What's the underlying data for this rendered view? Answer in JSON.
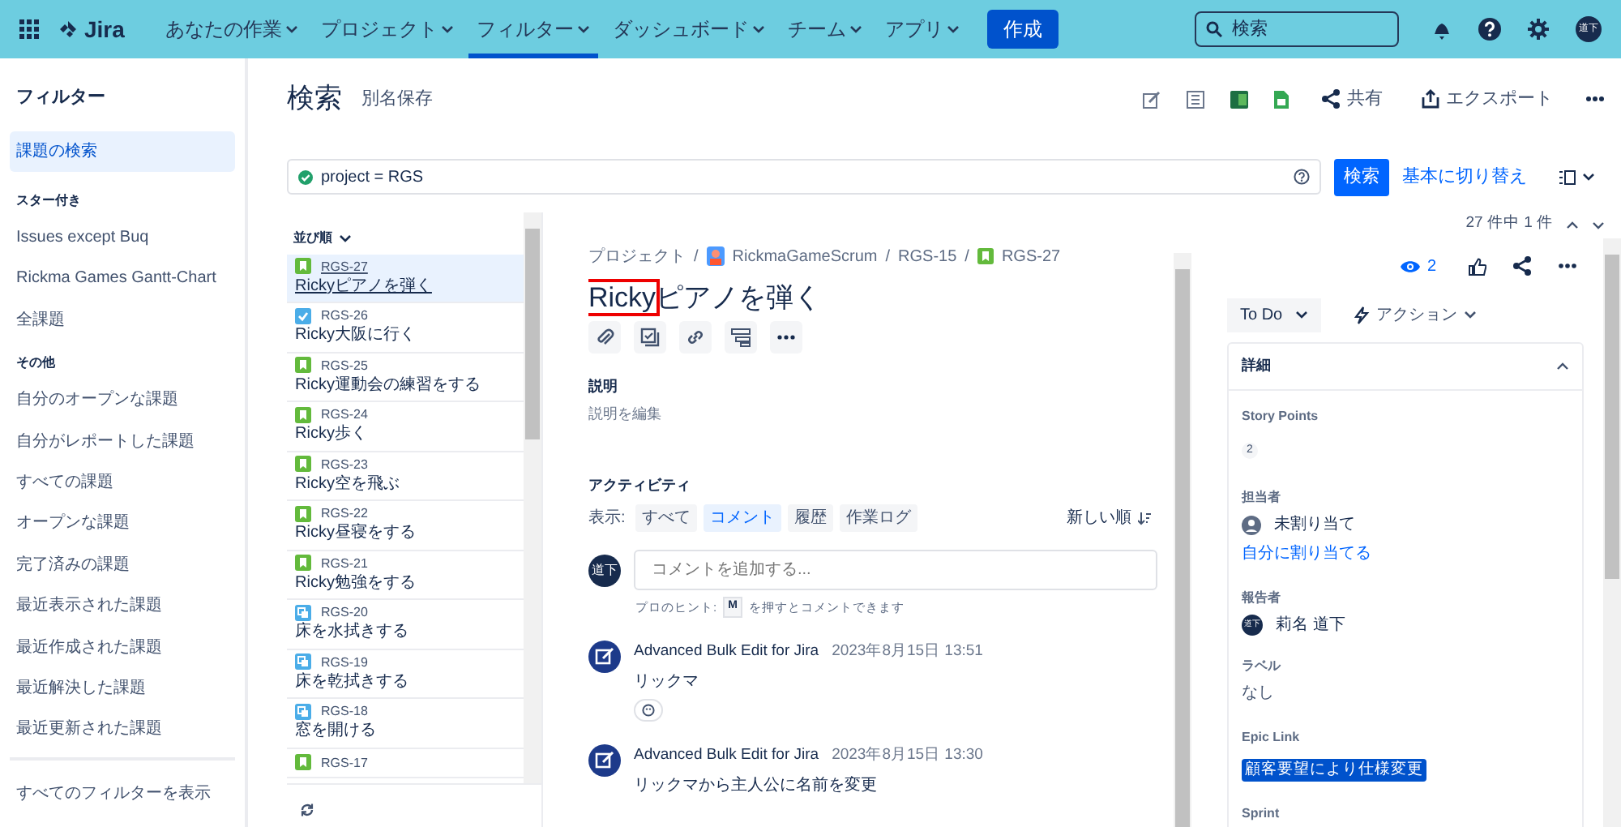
{
  "nav": {
    "logo": "Jira",
    "menus": [
      {
        "label": "あなたの作業",
        "selected": false
      },
      {
        "label": "プロジェクト",
        "selected": false
      },
      {
        "label": "フィルター",
        "selected": true
      },
      {
        "label": "ダッシュボード",
        "selected": false
      },
      {
        "label": "チーム",
        "selected": false
      },
      {
        "label": "アプリ",
        "selected": false
      }
    ],
    "create": "作成",
    "search_placeholder": "検索",
    "avatar": "道下"
  },
  "sidebar": {
    "title": "フィルター",
    "sections": [
      {
        "items": [
          {
            "label": "課題の検索",
            "selected": true
          }
        ]
      },
      {
        "heading": "スター付き",
        "items": [
          {
            "label": "Issues except Buq",
            "selected": false
          },
          {
            "label": "Rickma Games Gantt-Chart",
            "selected": false
          },
          {
            "label": "全課題",
            "selected": false
          }
        ]
      },
      {
        "heading": "その他",
        "items": [
          {
            "label": "自分のオープンな課題",
            "selected": false
          },
          {
            "label": "自分がレポートした課題",
            "selected": false
          },
          {
            "label": "すべての課題",
            "selected": false
          },
          {
            "label": "オープンな課題",
            "selected": false
          },
          {
            "label": "完了済みの課題",
            "selected": false
          },
          {
            "label": "最近表示された課題",
            "selected": false
          },
          {
            "label": "最近作成された課題",
            "selected": false
          },
          {
            "label": "最近解決した課題",
            "selected": false
          },
          {
            "label": "最近更新された課題",
            "selected": false
          }
        ]
      }
    ],
    "footer": "すべてのフィルターを表示"
  },
  "header": {
    "title": "検索",
    "save_as": "別名保存",
    "share": "共有",
    "export": "エクスポート"
  },
  "jql": {
    "query": "project = RGS",
    "search": "検索",
    "switch": "基本に切り替え"
  },
  "issue_list": {
    "sort": "並び順",
    "items": [
      {
        "key": "RGS-27",
        "summary": "Rickyピアノを弾く",
        "kind": "story",
        "selected": true
      },
      {
        "key": "RGS-26",
        "summary": "Ricky大阪に行く",
        "kind": "task",
        "selected": false
      },
      {
        "key": "RGS-25",
        "summary": "Ricky運動会の練習をする",
        "kind": "story",
        "selected": false
      },
      {
        "key": "RGS-24",
        "summary": "Ricky歩く",
        "kind": "story",
        "selected": false
      },
      {
        "key": "RGS-23",
        "summary": "Ricky空を飛ぶ",
        "kind": "story",
        "selected": false
      },
      {
        "key": "RGS-22",
        "summary": "Ricky昼寝をする",
        "kind": "story",
        "selected": false
      },
      {
        "key": "RGS-21",
        "summary": "Ricky勉強をする",
        "kind": "story",
        "selected": false
      },
      {
        "key": "RGS-20",
        "summary": "床を水拭きする",
        "kind": "subtask",
        "selected": false
      },
      {
        "key": "RGS-19",
        "summary": "床を乾拭きする",
        "kind": "subtask",
        "selected": false
      },
      {
        "key": "RGS-18",
        "summary": "窓を開ける",
        "kind": "subtask",
        "selected": false
      },
      {
        "key": "RGS-17",
        "kind": "story",
        "selected": false
      }
    ]
  },
  "issue": {
    "breadcrumb_separator": "/",
    "breadcrumbs": [
      {
        "label": "プロジェクト"
      },
      {
        "label": "RickmaGameScrum",
        "kind": "project"
      },
      {
        "label": "RGS-15"
      },
      {
        "label": "RGS-27",
        "kind": "story"
      }
    ],
    "title_parts": [
      {
        "text": "Ricky",
        "boxed": true
      },
      {
        "text": "ピアノを弾く",
        "boxed": false
      }
    ],
    "description_label": "説明",
    "description_placeholder": "説明を編集",
    "activity": {
      "title": "アクティビティ",
      "show_label": "表示:",
      "tabs": [
        {
          "label": "すべて",
          "selected": false
        },
        {
          "label": "コメント",
          "selected": true
        },
        {
          "label": "履歴",
          "selected": false
        },
        {
          "label": "作業ログ",
          "selected": false
        }
      ],
      "order": "新しい順",
      "comment_avatar": "道下",
      "comment_placeholder": "コメントを追加する...",
      "hint_before": "プロのヒント:",
      "hint_key": "M",
      "hint_after": "を押すとコメントできます",
      "comments": [
        {
          "author": "Advanced Bulk Edit for Jira",
          "time": "2023年8月15日 13:51",
          "body": "リックマ"
        },
        {
          "author": "Advanced Bulk Edit for Jira",
          "time": "2023年8月15日 13:30",
          "body": "リックマから主人公に名前を変更"
        }
      ]
    }
  },
  "side_panel": {
    "counter": "27 件中 1 件",
    "watchers": "2",
    "status": "To Do",
    "action": "アクション",
    "details_title": "詳細",
    "story_points_label": "Story Points",
    "story_points": "2",
    "assignee_label": "担当者",
    "assignee": "未割り当て",
    "assign_me": "自分に割り当てる",
    "reporter_label": "報告者",
    "reporter_avatar": "道下",
    "reporter": "莉名 道下",
    "labels_label": "ラベル",
    "labels": "なし",
    "epic_label": "Epic Link",
    "epic": "顧客要望により仕様変更",
    "sprint_label": "Sprint"
  }
}
